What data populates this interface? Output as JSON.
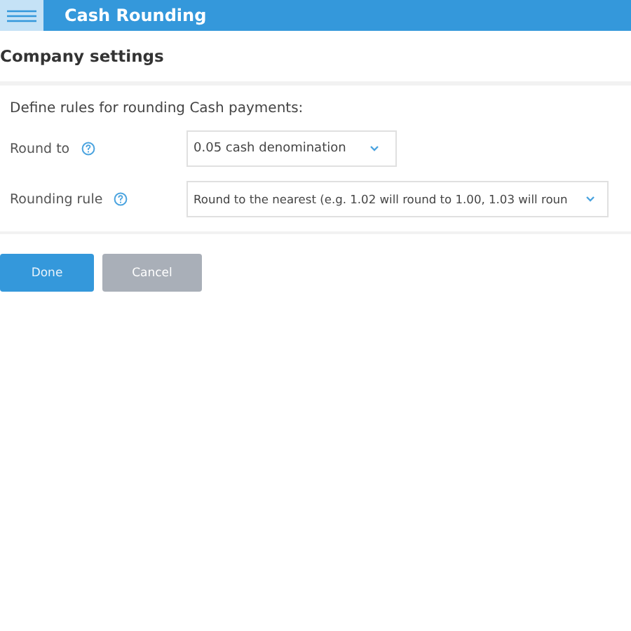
{
  "header": {
    "title": "Cash Rounding"
  },
  "section": {
    "title": "Company settings"
  },
  "description": "Define rules for rounding Cash payments:",
  "fields": [
    {
      "label": "Round to",
      "value": "0.05 cash denomination",
      "wide": false
    },
    {
      "label": "Rounding rule",
      "value": "Round to the nearest (e.g. 1.02 will round to 1.00, 1.03 will roun",
      "wide": true
    }
  ],
  "buttons": [
    {
      "label": "Done",
      "kind": "primary",
      "disabled": false
    },
    {
      "label": "Cancel",
      "kind": "secondary",
      "disabled": true
    }
  ]
}
